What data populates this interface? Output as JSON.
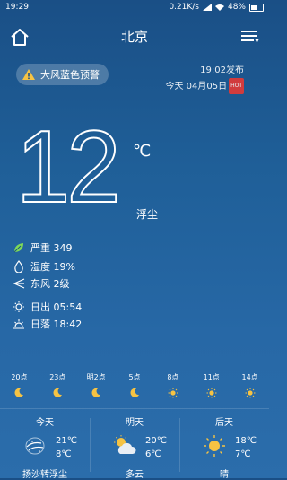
{
  "status_bar": {
    "time": "19:29",
    "speed": "0.21K/s",
    "battery": "48%"
  },
  "header": {
    "city": "北京"
  },
  "alert": {
    "label": "大风蓝色预警"
  },
  "publish": {
    "time": "19:02发布",
    "date": "今天 04月05日",
    "hot_badge": "HOT"
  },
  "current": {
    "temperature": "12",
    "unit": "℃",
    "condition": "浮尘"
  },
  "details": {
    "aqi": "严重 349",
    "humidity": "湿度 19%",
    "wind": "东风 2级",
    "sunrise": "日出 05:54",
    "sunset": "日落 18:42"
  },
  "hourly": [
    {
      "time": "20点",
      "icon": "moon-icon"
    },
    {
      "time": "23点",
      "icon": "moon-icon"
    },
    {
      "time": "明2点",
      "icon": "moon-icon"
    },
    {
      "time": "5点",
      "icon": "moon-icon"
    },
    {
      "time": "8点",
      "icon": "sun-icon"
    },
    {
      "time": "11点",
      "icon": "sun-icon"
    },
    {
      "time": "14点",
      "icon": "sun-icon"
    }
  ],
  "daily": [
    {
      "name": "今天",
      "high": "21℃",
      "low": "8℃",
      "condition": "扬沙转浮尘",
      "icon": "sandstorm-icon"
    },
    {
      "name": "明天",
      "high": "20℃",
      "low": "6℃",
      "condition": "多云",
      "icon": "partly-cloudy-icon"
    },
    {
      "name": "后天",
      "high": "18℃",
      "low": "7℃",
      "condition": "晴",
      "icon": "sun-icon"
    }
  ],
  "colors": {
    "background_top": "#1a4f86",
    "background_bottom": "#2b6dab",
    "accent_sun": "#f6c343",
    "alert_icon": "#f6c343",
    "hot_badge": "#e53935",
    "leaf_green": "#7ed957"
  }
}
